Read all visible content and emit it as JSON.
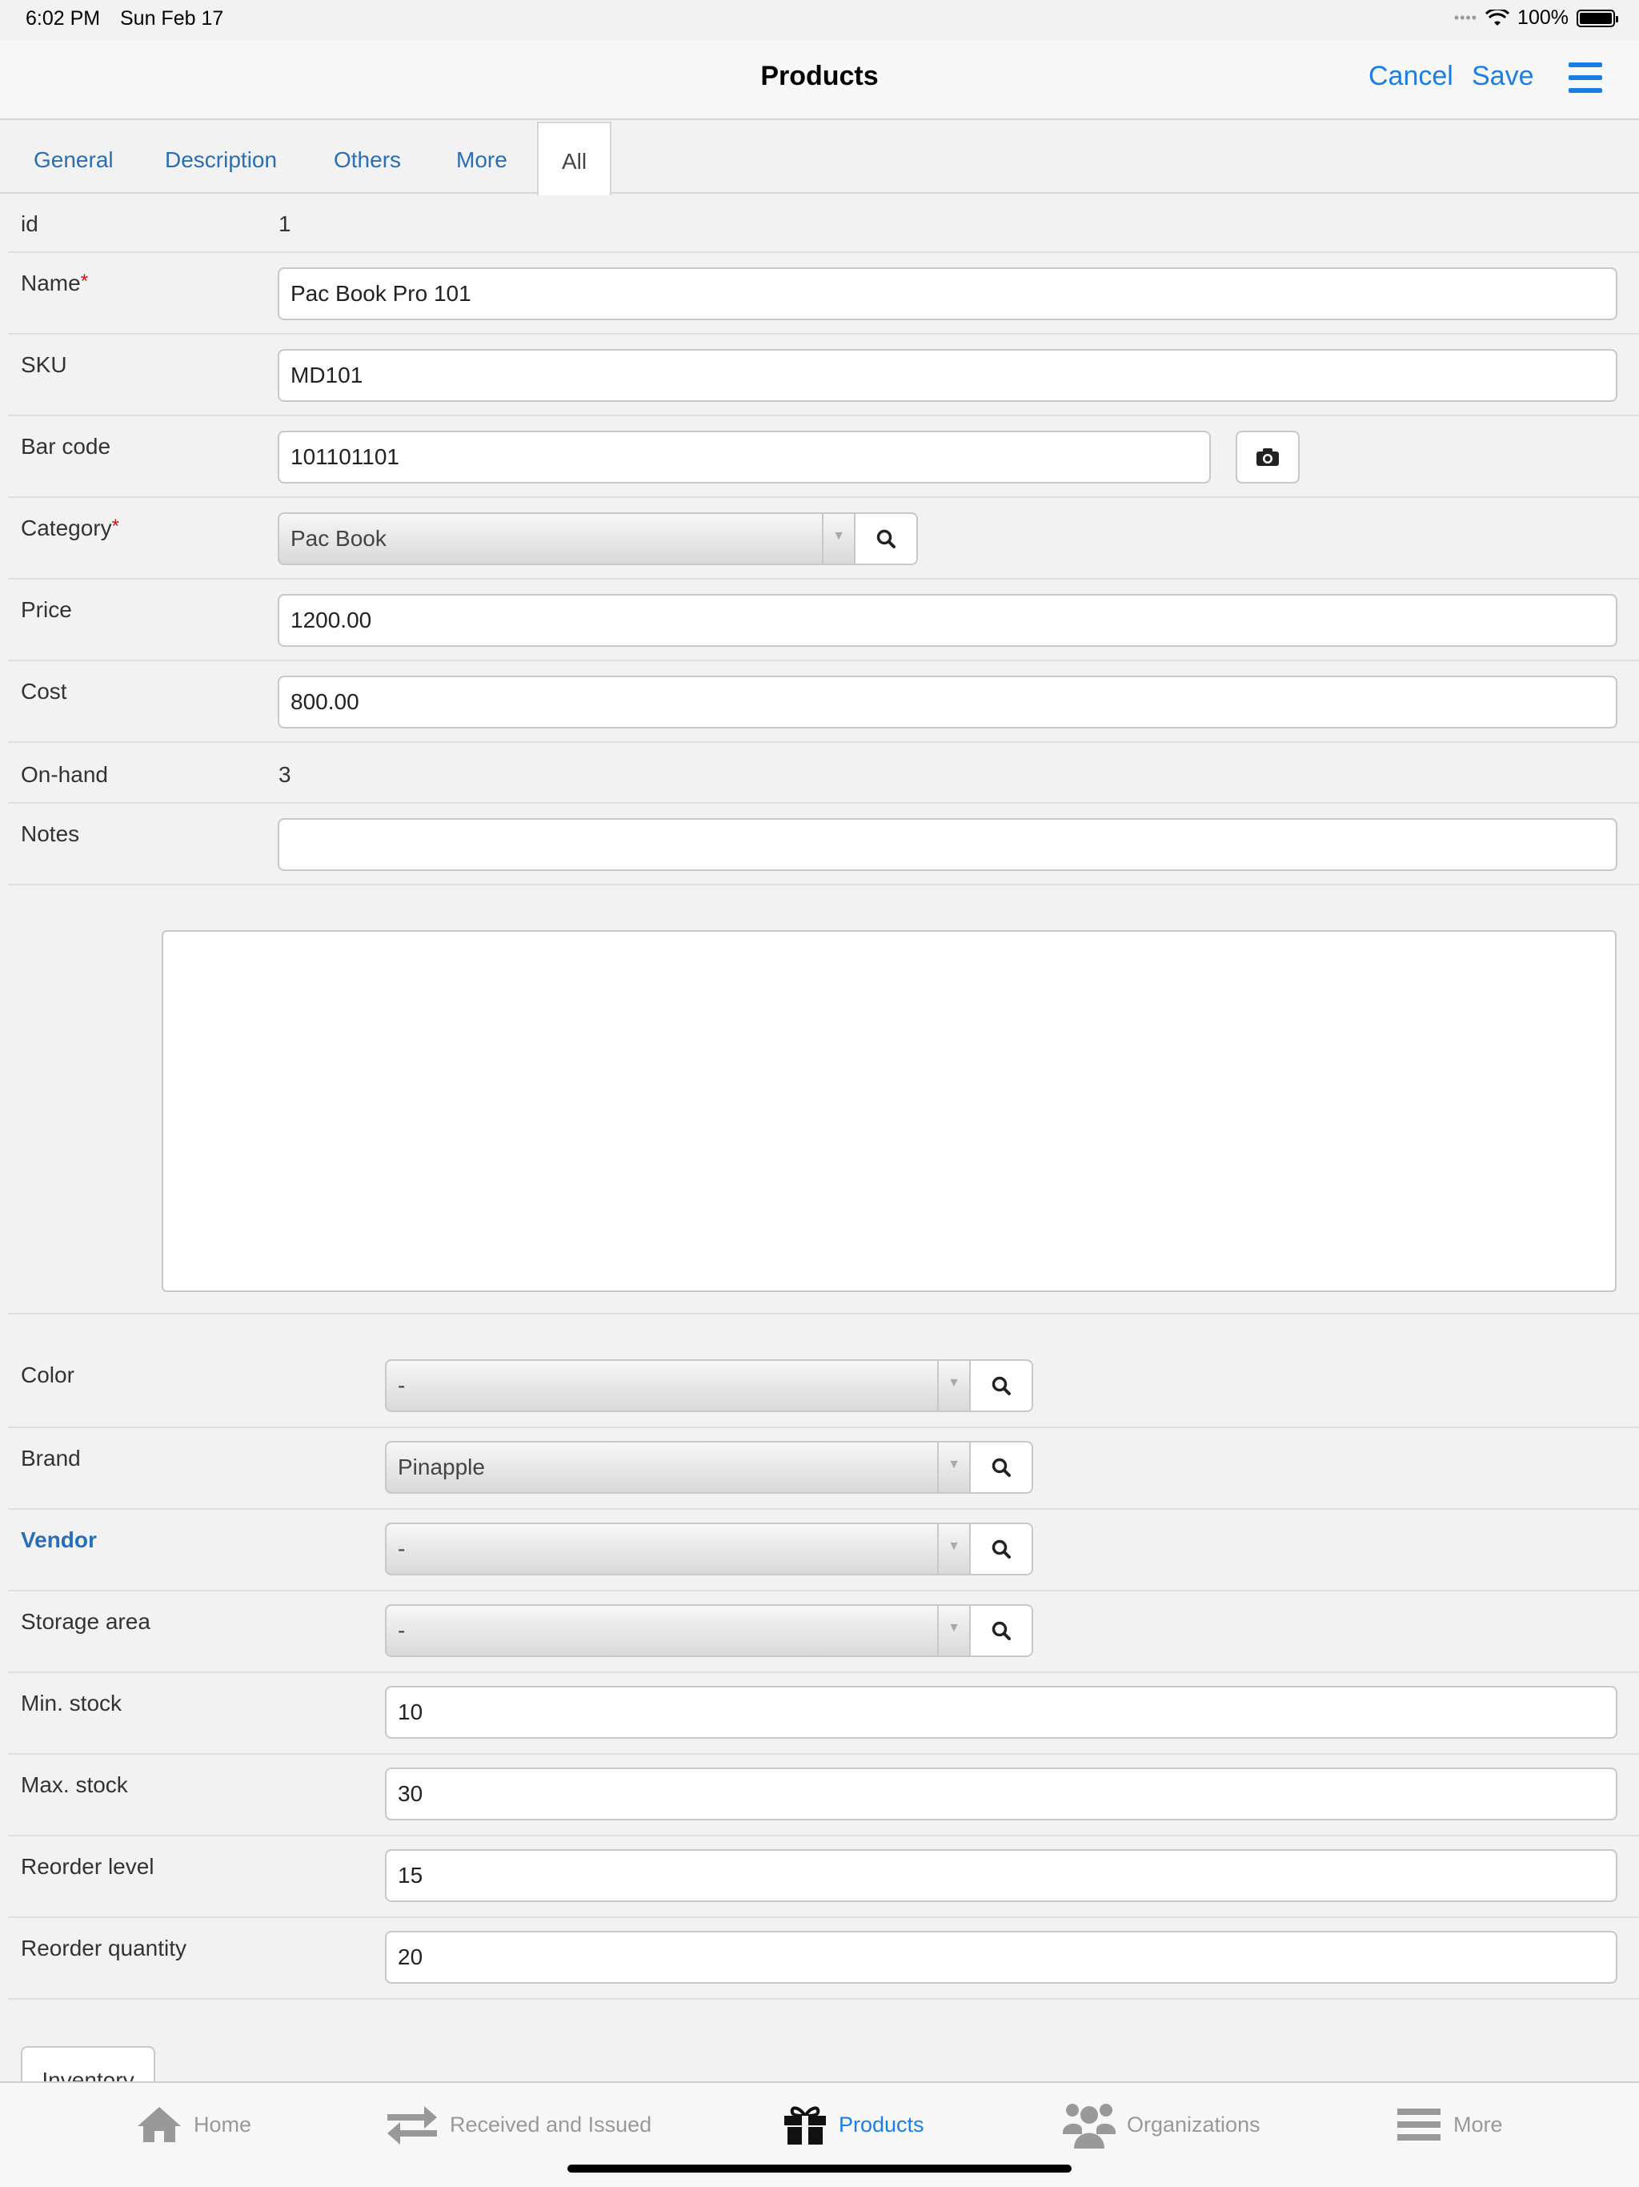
{
  "status_bar": {
    "time": "6:02 PM",
    "date": "Sun Feb 17",
    "battery": "100%"
  },
  "navbar": {
    "title": "Products",
    "cancel": "Cancel",
    "save": "Save"
  },
  "tabs": [
    "General",
    "Description",
    "Others",
    "More",
    "All"
  ],
  "active_tab": "All",
  "form": {
    "id": {
      "label": "id",
      "value": "1"
    },
    "name": {
      "label": "Name",
      "value": "Pac Book Pro 101",
      "required": "*"
    },
    "sku": {
      "label": "SKU",
      "value": "MD101"
    },
    "barcode": {
      "label": "Bar code",
      "value": "101101101"
    },
    "category": {
      "label": "Category",
      "value": "Pac Book",
      "required": "*"
    },
    "price": {
      "label": "Price",
      "value": "1200.00"
    },
    "cost": {
      "label": "Cost",
      "value": "800.00"
    },
    "onhand": {
      "label": "On-hand",
      "value": "3"
    },
    "notes": {
      "label": "Notes",
      "value": ""
    },
    "color": {
      "label": "Color",
      "value": "-"
    },
    "brand": {
      "label": "Brand",
      "value": "Pinapple"
    },
    "vendor": {
      "label": "Vendor",
      "value": "-"
    },
    "storage": {
      "label": "Storage area",
      "value": "-"
    },
    "min_stock": {
      "label": "Min. stock",
      "value": "10"
    },
    "max_stock": {
      "label": "Max. stock",
      "value": "30"
    },
    "reorder_level": {
      "label": "Reorder level",
      "value": "15"
    },
    "reorder_qty": {
      "label": "Reorder quantity",
      "value": "20"
    }
  },
  "inventory_button": "Inventory",
  "tabbar": {
    "items": [
      {
        "label": "Home",
        "icon": "home-icon"
      },
      {
        "label": "Received and Issued",
        "icon": "transfer-arrows-icon"
      },
      {
        "label": "Products",
        "icon": "gift-icon"
      },
      {
        "label": "Organizations",
        "icon": "users-icon"
      },
      {
        "label": "More",
        "icon": "menu-icon"
      }
    ],
    "active": "Products"
  },
  "colors": {
    "accent": "#1a7ee6",
    "link": "#2a6eb5",
    "required": "#d01010"
  }
}
